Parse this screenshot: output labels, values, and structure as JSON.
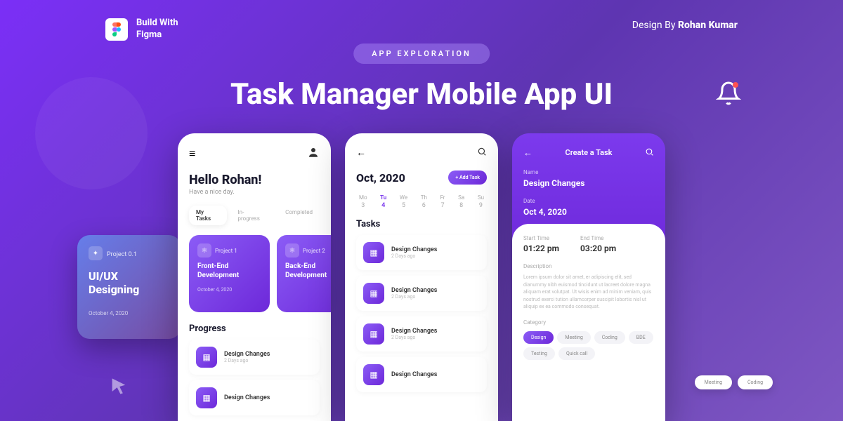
{
  "brand": "Build With\nFigma",
  "credit_pre": "Design By ",
  "credit_name": "Rohan Kumar",
  "badge": "APP EXPLORATION",
  "title": "Task Manager Mobile App UI",
  "float": {
    "proj": "Project 0.1",
    "title": "UI/UX Designing",
    "date": "October 4, 2020"
  },
  "p1": {
    "greeting": "Hello Rohan!",
    "sub": "Have a nice day.",
    "tabs": [
      "My Tasks",
      "In- progress",
      "Completed"
    ],
    "cards": [
      {
        "label": "Project 1",
        "title": "Front-End Development",
        "date": "October 4, 2020"
      },
      {
        "label": "Project 2",
        "title": "Back-End Development",
        "date": ""
      }
    ],
    "progress_title": "Progress",
    "tasks": [
      {
        "name": "Design Changes",
        "sub": "2 Days ago"
      },
      {
        "name": "Design Changes",
        "sub": ""
      }
    ]
  },
  "p2": {
    "month": "Oct, 2020",
    "add": "+ Add Task",
    "days": [
      {
        "d": "Mo",
        "n": "3"
      },
      {
        "d": "Tu",
        "n": "4"
      },
      {
        "d": "We",
        "n": "5"
      },
      {
        "d": "Th",
        "n": "6"
      },
      {
        "d": "Fr",
        "n": "7"
      },
      {
        "d": "Sa",
        "n": "8"
      },
      {
        "d": "Su",
        "n": "9"
      }
    ],
    "tasks_title": "Tasks",
    "tasks": [
      {
        "name": "Design Changes",
        "sub": "2 Days ago"
      },
      {
        "name": "Design Changes",
        "sub": "2 Days ago"
      },
      {
        "name": "Design Changes",
        "sub": "2 Days ago"
      },
      {
        "name": "Design Changes",
        "sub": ""
      }
    ]
  },
  "p3": {
    "title": "Create a Task",
    "name_label": "Name",
    "name": "Design Changes",
    "date_label": "Date",
    "date": "Oct 4, 2020",
    "start_label": "Start Time",
    "start": "01:22 pm",
    "end_label": "End Time",
    "end": "03:20 pm",
    "desc_label": "Description",
    "desc": "Lorem ipsum dolor sit amet, er adipiscing elit, sed dianummy nibh euismod tincidunt ut lacreet dolore magna aliquam erat volutpat. Ut wisis enim ad minim veniam, quis nostrud exerci tution ullamcorper suscipit lobortis nisl ut aliquip ex ea commodo consequat.",
    "cat_label": "Category",
    "cats": [
      "Design",
      "Meeting",
      "Coding",
      "BDE",
      "Testing",
      "Quick call"
    ]
  },
  "extra": [
    "Meeting",
    "Coding"
  ]
}
